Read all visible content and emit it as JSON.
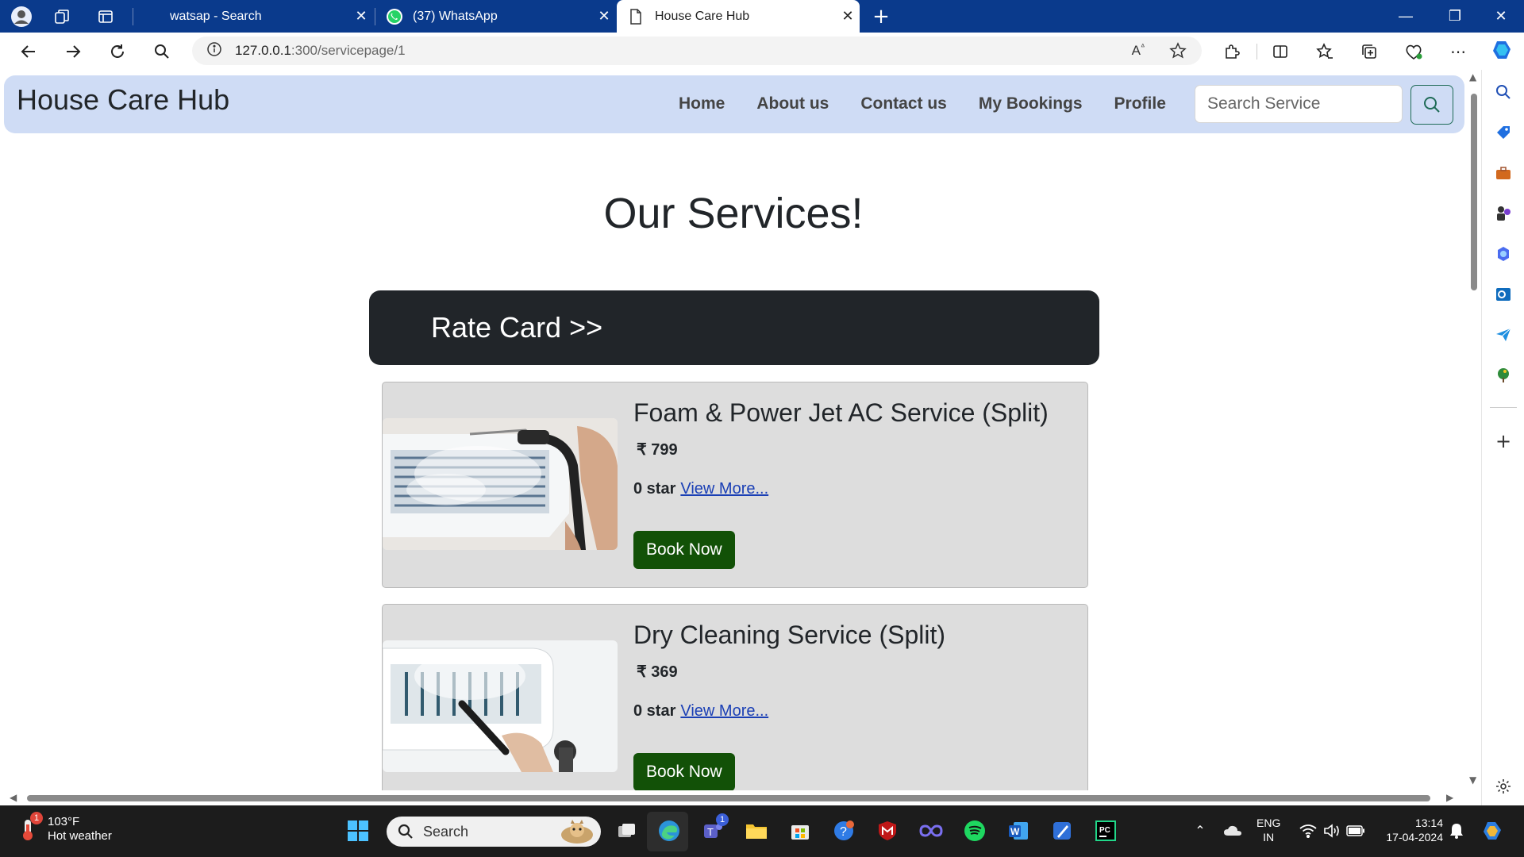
{
  "browser": {
    "tabs": [
      {
        "title": "watsap - Search",
        "active": false
      },
      {
        "title": "(37) WhatsApp",
        "active": false
      },
      {
        "title": "House Care Hub",
        "active": true
      }
    ],
    "url_host": "127.0.0.1",
    "url_path": ":300/servicepage/1"
  },
  "site": {
    "brand": "House Care Hub",
    "nav": [
      "Home",
      "About us",
      "Contact us",
      "My Bookings",
      "Profile"
    ],
    "search_placeholder": "Search Service"
  },
  "main": {
    "title": "Our Services!",
    "rate_card": "Rate Card >>",
    "services": [
      {
        "name": "Foam & Power Jet AC Service (Split)",
        "price": "₹ 799",
        "rating": "0 star",
        "view_more": "View More...",
        "book": "Book Now"
      },
      {
        "name": "Dry Cleaning Service (Split)",
        "price": "₹ 369",
        "rating": "0 star",
        "view_more": "View More...",
        "book": "Book Now"
      }
    ]
  },
  "taskbar": {
    "weather_temp": "103°F",
    "weather_desc": "Hot weather",
    "weather_badge": "1",
    "search_label": "Search",
    "teams_badge": "1",
    "lang_top": "ENG",
    "lang_bottom": "IN",
    "time": "13:14",
    "date": "17-04-2024"
  },
  "colors": {
    "tabstrip": "#0a3a8c",
    "navbar": "#cfdcf5",
    "rate_card": "#212529",
    "book_button": "#125107",
    "card_bg": "#dddddd"
  }
}
